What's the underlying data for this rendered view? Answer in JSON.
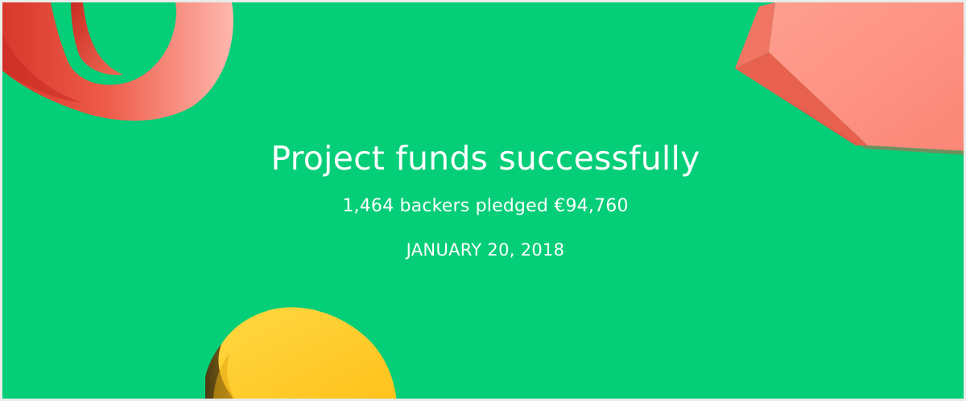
{
  "banner": {
    "title": "Project funds successfully",
    "backers_line": "1,464 backers pledged €94,760",
    "date": "JANUARY 20, 2018"
  },
  "colors": {
    "background": "#05ce78",
    "text": "#ffffff",
    "ring": "#f57a6a",
    "cube": "#fb8f80",
    "disc": "#ffd23a"
  }
}
